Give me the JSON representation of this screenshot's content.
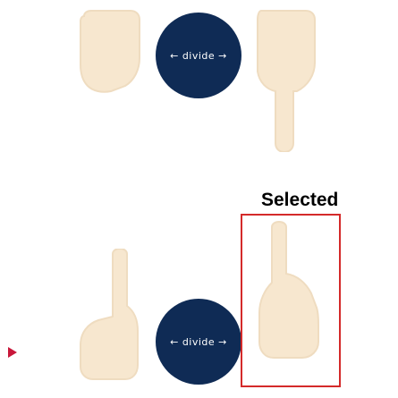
{
  "game": {
    "opponent": {
      "left_hand": {
        "fingers": 0
      },
      "right_hand": {
        "fingers": 1
      }
    },
    "player": {
      "left_hand": {
        "fingers": 1
      },
      "right_hand": {
        "fingers": 1,
        "selected": true
      }
    },
    "divide_button_top": {
      "label": "← divide →"
    },
    "divide_button_bottom": {
      "label": "← divide →"
    },
    "selected_label": "Selected",
    "turn_indicator": "player"
  },
  "colors": {
    "hand_fill": "#f7e7cf",
    "hand_stroke": "#efdcc0",
    "button_bg": "#0f2b55",
    "button_text": "#ffffff",
    "selection_border": "#d42a2a",
    "turn_arrow": "#c8173a"
  },
  "icons": {
    "hand": "hand-icon",
    "turn": "play-arrow-icon"
  }
}
